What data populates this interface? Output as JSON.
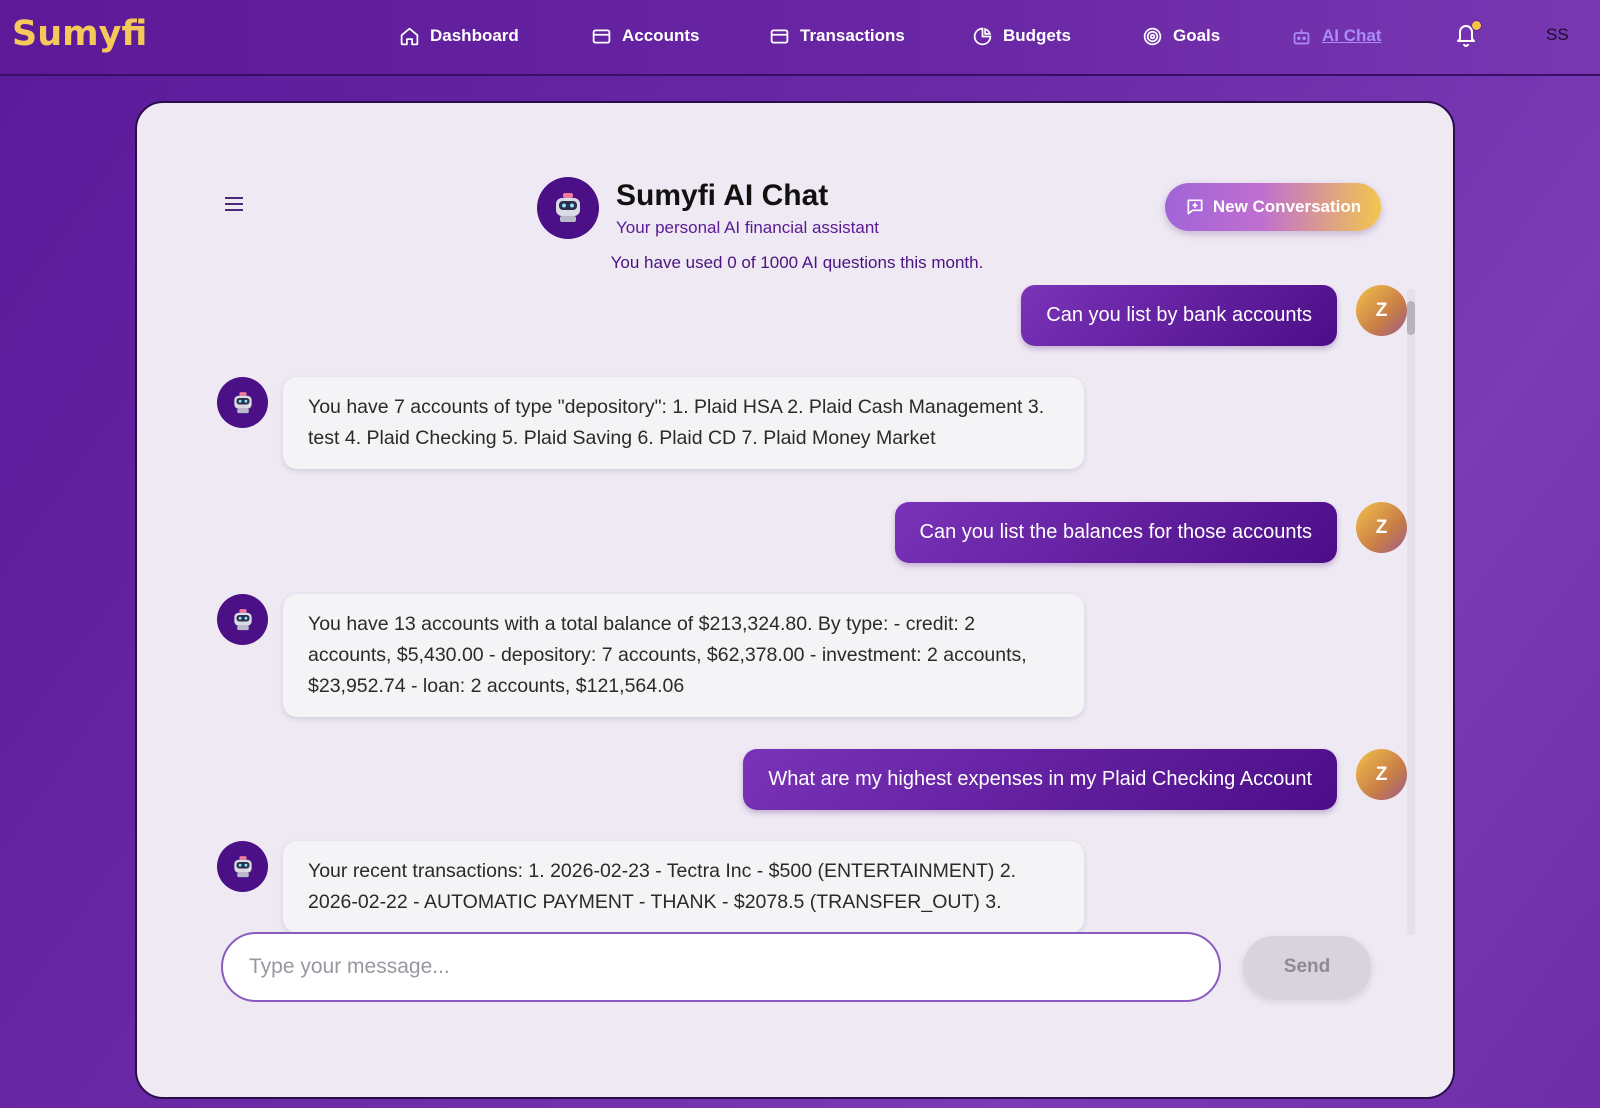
{
  "app": {
    "brand": "Sumyfi",
    "user_initials": "SS"
  },
  "nav": {
    "items": [
      {
        "label": "Dashboard",
        "icon": "home-icon"
      },
      {
        "label": "Accounts",
        "icon": "card-icon"
      },
      {
        "label": "Transactions",
        "icon": "card-icon"
      },
      {
        "label": "Budgets",
        "icon": "pie-chart-icon"
      },
      {
        "label": "Goals",
        "icon": "target-icon"
      },
      {
        "label": "AI Chat",
        "icon": "robot-icon",
        "active": true
      }
    ],
    "notifications": {
      "icon": "bell-icon",
      "has_unread": true
    }
  },
  "chat": {
    "title": "Sumyfi AI Chat",
    "subtitle": "Your personal AI financial assistant",
    "new_conversation_label": "New Conversation",
    "usage_text": "You have used 0 of 1000 AI questions this month.",
    "messages": [
      {
        "role": "user",
        "avatar": "Z",
        "text": "Can you list by bank accounts"
      },
      {
        "role": "assistant",
        "text": "You have 7 accounts of type \"depository\": 1. Plaid HSA 2. Plaid Cash Management 3. test 4. Plaid Checking 5. Plaid Saving 6. Plaid CD 7. Plaid Money Market"
      },
      {
        "role": "user",
        "avatar": "Z",
        "text": "Can you list the balances for those accounts"
      },
      {
        "role": "assistant",
        "text": "You have 13 accounts with a total balance of $213,324.80. By type: - credit: 2 accounts, $5,430.00 - depository: 7 accounts, $62,378.00 - investment: 2 accounts, $23,952.74 - loan: 2 accounts, $121,564.06"
      },
      {
        "role": "user",
        "avatar": "Z",
        "text": "What are my highest expenses in my Plaid Checking Account"
      },
      {
        "role": "assistant",
        "text": "Your recent transactions: 1. 2026-02-23 - Tectra Inc - $500 (ENTERTAINMENT) 2. 2026-02-22 - AUTOMATIC PAYMENT - THANK - $2078.5 (TRANSFER_OUT) 3."
      }
    ],
    "input_placeholder": "Type your message...",
    "input_value": "",
    "send_label": "Send"
  },
  "colors": {
    "brand": "#f5c85a",
    "accent_purple": "#4b0f86",
    "active_nav": "#a98cf5"
  }
}
